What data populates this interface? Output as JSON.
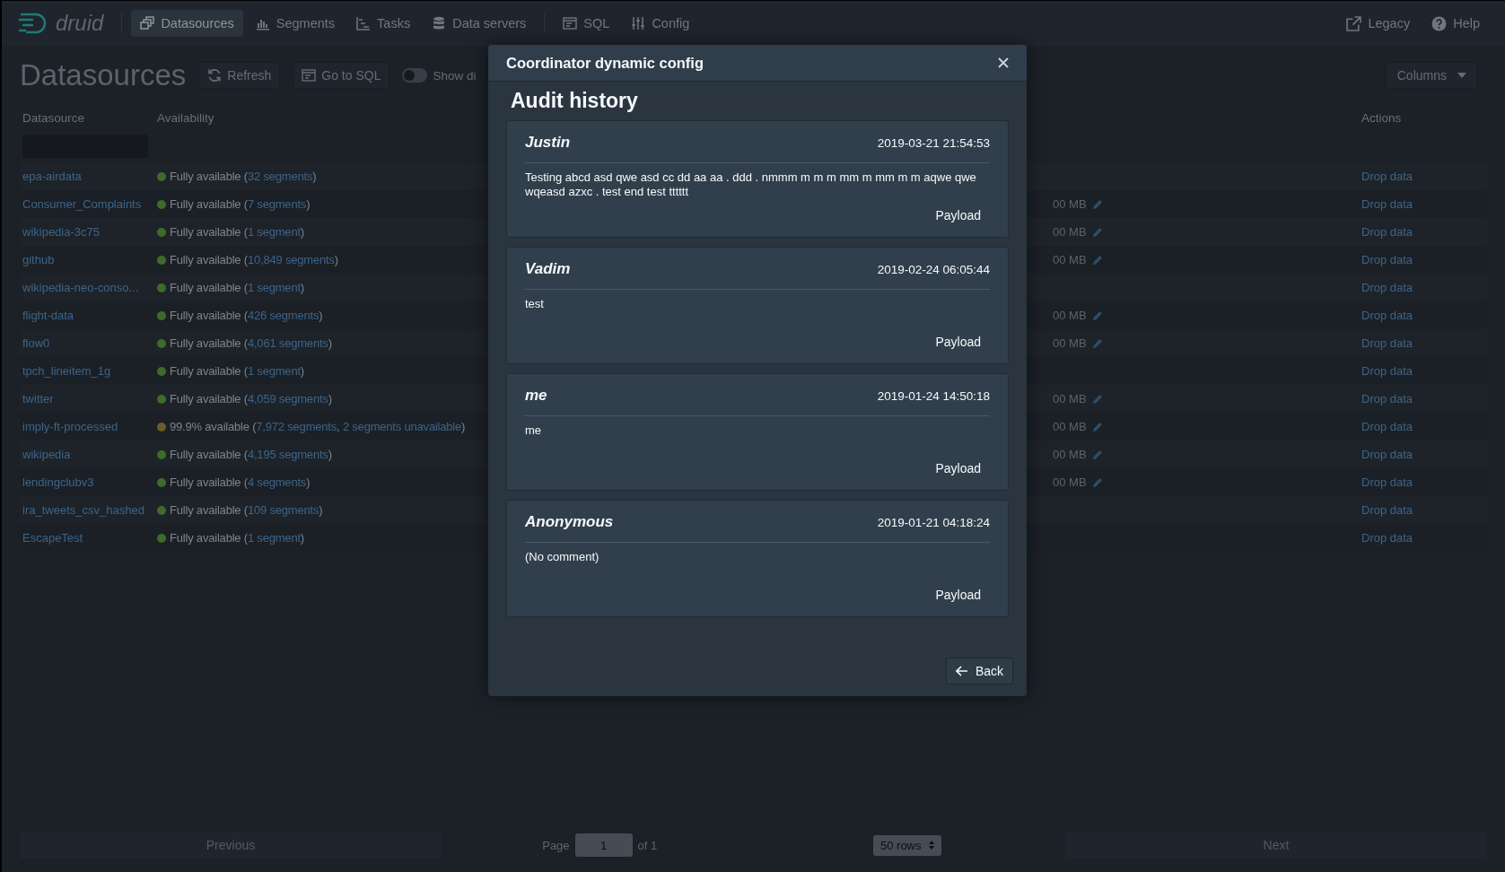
{
  "nav": {
    "logo": "druid",
    "items": [
      {
        "label": "Datasources",
        "selected": true
      },
      {
        "label": "Segments",
        "selected": false
      },
      {
        "label": "Tasks",
        "selected": false
      },
      {
        "label": "Data servers",
        "selected": false
      },
      {
        "label": "SQL",
        "selected": false
      },
      {
        "label": "Config",
        "selected": false
      }
    ],
    "right": [
      {
        "label": "Legacy"
      },
      {
        "label": "Help"
      }
    ]
  },
  "page": {
    "title": "Datasources",
    "refresh": "Refresh",
    "go_to_sql": "Go to SQL",
    "toggle": {
      "label": "Show di",
      "on": false
    },
    "columns": "Columns"
  },
  "table": {
    "columns": {
      "datasource": "Datasource",
      "availability": "Availability",
      "actions": "Actions"
    },
    "rows": [
      {
        "name": "epa-airdata",
        "color": "#3d6b2c",
        "availability": [
          "Fully available (",
          "32 segments",
          ")"
        ],
        "action": "Drop data"
      },
      {
        "name": "Consumer_Complaints",
        "color": "#3d6b2c",
        "availability": [
          "Fully available (",
          "7 segments",
          ")"
        ],
        "size": "00 MB",
        "action": "Drop data"
      },
      {
        "name": "wikipedia-3c75",
        "color": "#3d6b2c",
        "availability": [
          "Fully available (",
          "1 segment",
          ")"
        ],
        "size": "00 MB",
        "action": "Drop data"
      },
      {
        "name": "github",
        "color": "#3d6b2c",
        "availability": [
          "Fully available (",
          "10,849 segments",
          ")"
        ],
        "size": "00 MB",
        "action": "Drop data"
      },
      {
        "name": "wikipedia-neo-conso...",
        "color": "#3d6b2c",
        "availability": [
          "Fully available (",
          "1 segment",
          ")"
        ],
        "action": "Drop data"
      },
      {
        "name": "flight-data",
        "color": "#3d6b2c",
        "availability": [
          "Fully available (",
          "426 segments",
          ")"
        ],
        "size": "00 MB",
        "action": "Drop data"
      },
      {
        "name": "flow0",
        "color": "#3d6b2c",
        "availability": [
          "Fully available (",
          "4,061 segments",
          ")"
        ],
        "size": "00 MB",
        "action": "Drop data"
      },
      {
        "name": "tpch_lineitem_1g",
        "color": "#3d6b2c",
        "availability": [
          "Fully available (",
          "1 segment",
          ")"
        ],
        "action": "Drop data"
      },
      {
        "name": "twitter",
        "color": "#3d6b2c",
        "availability": [
          "Fully available (",
          "4,059 segments",
          ")"
        ],
        "size": "00 MB",
        "action": "Drop data"
      },
      {
        "name": "imply-ft-processed",
        "color": "#6e5a2c",
        "availability": [
          "99.9% available (",
          "7,972 segments",
          ", ",
          "2 segments unavailable",
          ")"
        ],
        "size": "00 MB",
        "action": "Drop data"
      },
      {
        "name": "wikipedia",
        "color": "#3d6b2c",
        "availability": [
          "Fully available (",
          "4,195 segments",
          ")"
        ],
        "size": "00 MB",
        "action": "Drop data"
      },
      {
        "name": "lendingclubv3",
        "color": "#3d6b2c",
        "availability": [
          "Fully available (",
          "4 segments",
          ")"
        ],
        "size": "00 MB",
        "action": "Drop data"
      },
      {
        "name": "ira_tweets_csv_hashed",
        "color": "#3d6b2c",
        "availability": [
          "Fully available (",
          "109 segments",
          ")"
        ],
        "action": "Drop data"
      },
      {
        "name": "EscapeTest",
        "color": "#3d6b2c",
        "availability": [
          "Fully available (",
          "1 segment",
          ")"
        ],
        "action": "Drop data"
      }
    ]
  },
  "pagination": {
    "previous": {
      "label": "Previous",
      "disabled": true
    },
    "page_label": "Page",
    "page": "1",
    "of": "of 1",
    "rows": "50 rows",
    "next": {
      "label": "Next",
      "disabled": true
    }
  },
  "dialog": {
    "title": "Coordinator dynamic config",
    "heading": "Audit history",
    "entries": [
      {
        "author": "Justin",
        "time": "2019-03-21 21:54:53",
        "comment": "Testing abcd asd qwe asd cc dd aa aa . ddd . nmmm m m m mm m mm m m aqwe qwe wqeasd azxc . test end test tttttt",
        "button": "Payload"
      },
      {
        "author": "Vadim",
        "time": "2019-02-24 06:05:44",
        "comment": "test",
        "button": "Payload"
      },
      {
        "author": "me",
        "time": "2019-01-24 14:50:18",
        "comment": "me",
        "button": "Payload"
      },
      {
        "author": "Anonymous",
        "time": "2019-01-21 04:18:24",
        "comment": "(No comment)",
        "button": "Payload"
      }
    ],
    "back": "Back"
  }
}
